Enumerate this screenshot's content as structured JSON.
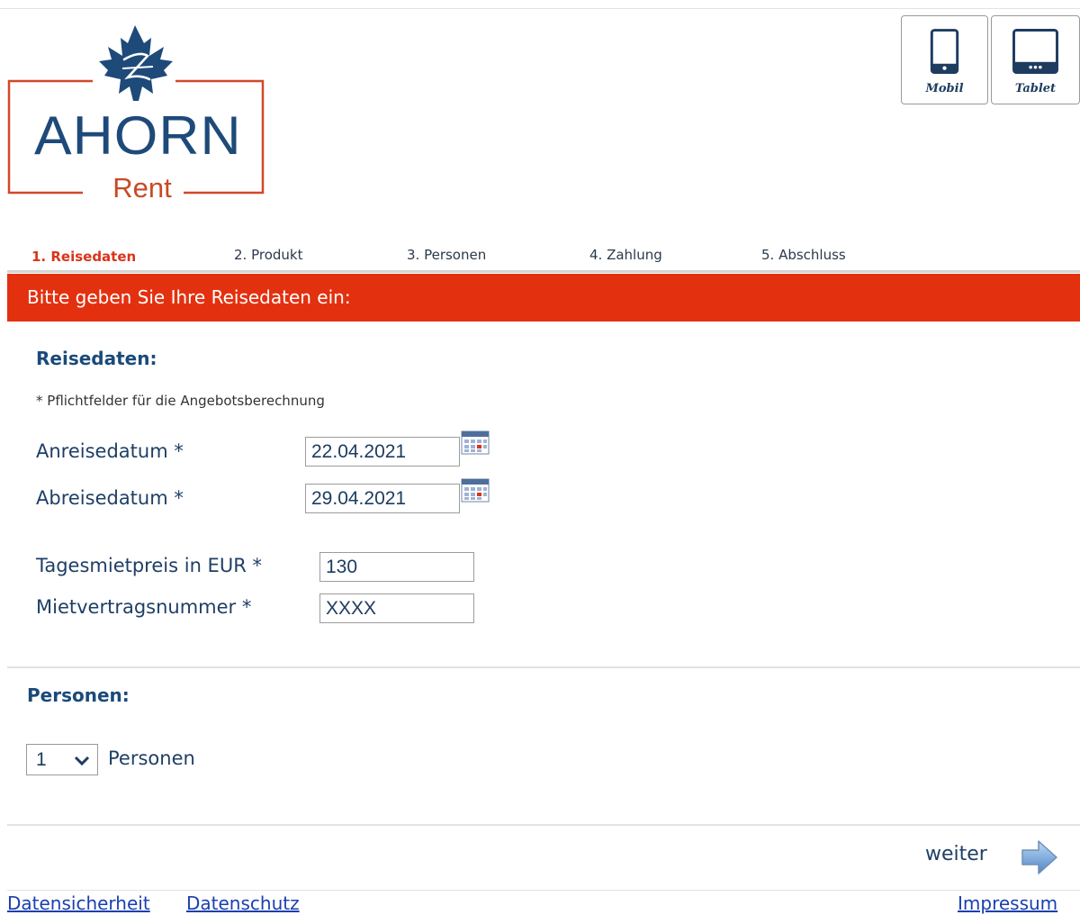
{
  "logo": {
    "brand": "AHORN",
    "sub": "Rent"
  },
  "devices": {
    "mobil_label": "Mobil",
    "tablet_label": "Tablet"
  },
  "steps": [
    {
      "label": "1. Reisedaten",
      "active": true
    },
    {
      "label": "2. Produkt",
      "active": false
    },
    {
      "label": "3. Personen",
      "active": false
    },
    {
      "label": "4. Zahlung",
      "active": false
    },
    {
      "label": "5. Abschluss",
      "active": false
    }
  ],
  "banner": {
    "text": "Bitte geben Sie Ihre Reisedaten ein:"
  },
  "reisedaten": {
    "title": "Reisedaten:",
    "note": "* Pflichtfelder für die Angebotsberechnung",
    "anreise_label": "Anreisedatum *",
    "anreise_value": "22.04.2021",
    "abreise_label": "Abreisedatum *",
    "abreise_value": "29.04.2021",
    "tagesmietpreis_label": "Tagesmietpreis in EUR *",
    "tagesmietpreis_value": "130",
    "mietvertrag_label": "Mietvertragsnummer *",
    "mietvertrag_value": "XXXX"
  },
  "personen": {
    "title": "Personen:",
    "selected": "1",
    "label": "Personen"
  },
  "nav": {
    "weiter": "weiter"
  },
  "footer": {
    "datensicherheit": "Datensicherheit",
    "datenschutz": "Datenschutz",
    "impressum": "Impressum"
  },
  "colors": {
    "accent_red": "#e3310f",
    "brand_blue": "#1e4a7a",
    "link_blue": "#1a3fb0"
  },
  "icons": {
    "logo_mark": "maple-leaf-icon",
    "mobil": "smartphone-icon",
    "tablet": "tablet-icon",
    "calendar": "calendar-icon",
    "select": "chevron-down-icon",
    "next": "arrow-right-icon"
  }
}
